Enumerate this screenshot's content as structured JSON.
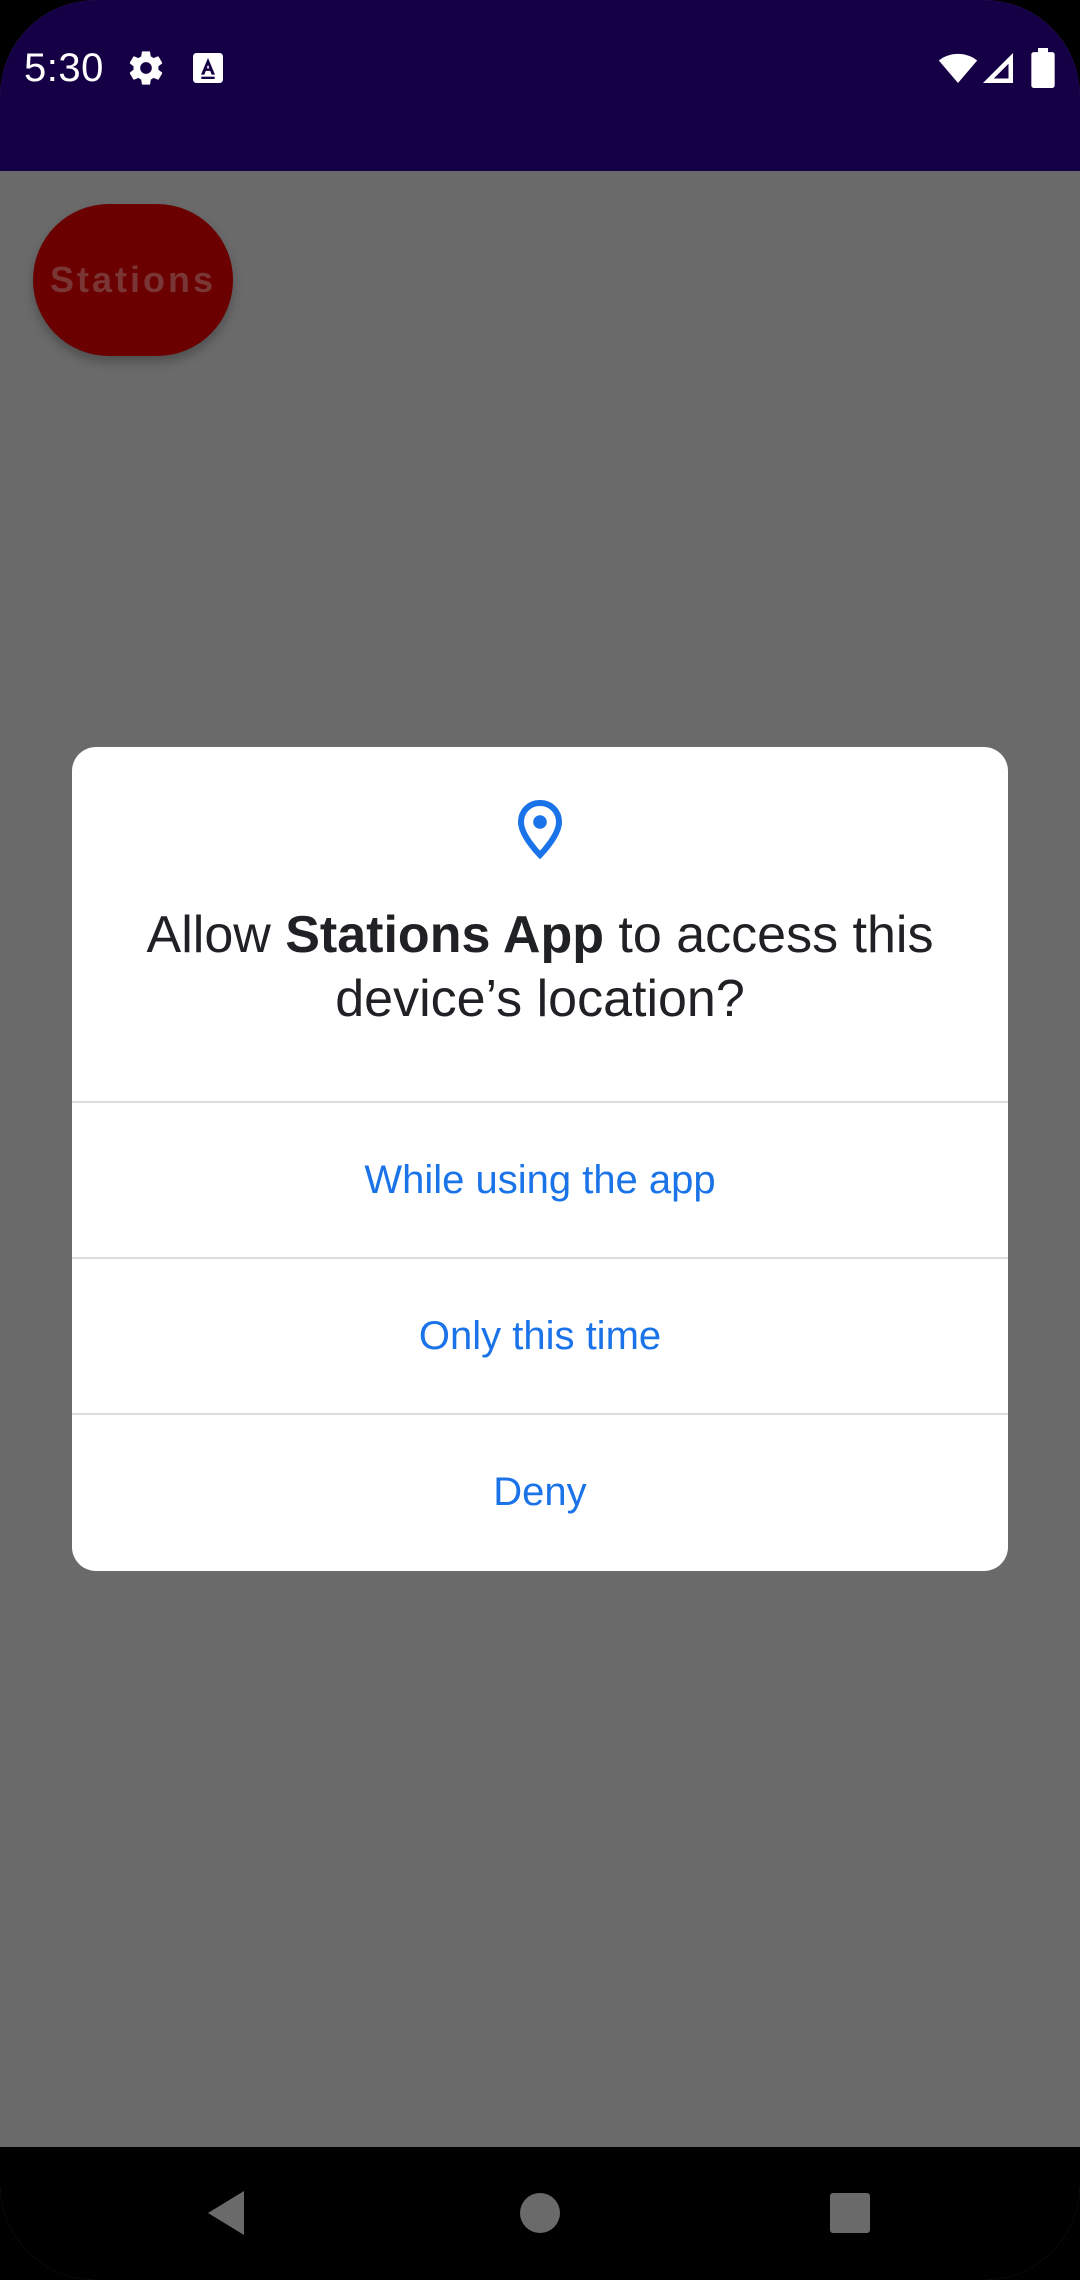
{
  "status_bar": {
    "time": "5:30",
    "background": "#160045",
    "icons_left": [
      "gear-icon",
      "text-a-icon"
    ],
    "icons_right": [
      "wifi-icon",
      "signal-icon",
      "battery-icon"
    ]
  },
  "app": {
    "stations_label": "Stations",
    "chip_color": "#6b0000"
  },
  "dialog": {
    "icon": "location-pin-icon",
    "title_prefix": "Allow ",
    "title_app": "Stations App",
    "title_suffix": " to access this device’s location?",
    "options": [
      {
        "label": "While using the app"
      },
      {
        "label": "Only this time"
      },
      {
        "label": "Deny"
      }
    ],
    "accent": "#1a73e8"
  },
  "nav_bar": {
    "buttons": [
      "back-icon",
      "home-icon",
      "recents-icon"
    ]
  }
}
